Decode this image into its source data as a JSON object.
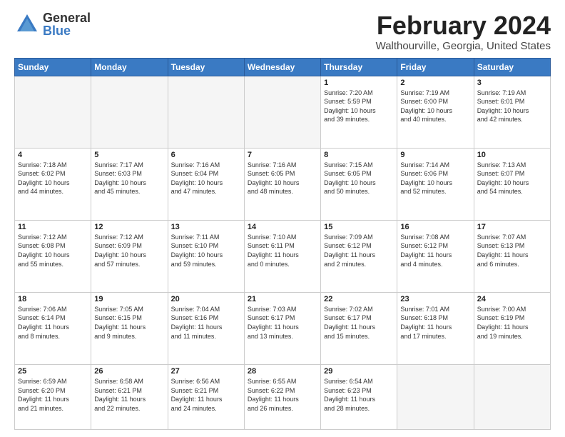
{
  "header": {
    "logo_general": "General",
    "logo_blue": "Blue",
    "month_title": "February 2024",
    "location": "Walthourville, Georgia, United States"
  },
  "weekdays": [
    "Sunday",
    "Monday",
    "Tuesday",
    "Wednesday",
    "Thursday",
    "Friday",
    "Saturday"
  ],
  "weeks": [
    [
      {
        "day": "",
        "info": ""
      },
      {
        "day": "",
        "info": ""
      },
      {
        "day": "",
        "info": ""
      },
      {
        "day": "",
        "info": ""
      },
      {
        "day": "1",
        "info": "Sunrise: 7:20 AM\nSunset: 5:59 PM\nDaylight: 10 hours\nand 39 minutes."
      },
      {
        "day": "2",
        "info": "Sunrise: 7:19 AM\nSunset: 6:00 PM\nDaylight: 10 hours\nand 40 minutes."
      },
      {
        "day": "3",
        "info": "Sunrise: 7:19 AM\nSunset: 6:01 PM\nDaylight: 10 hours\nand 42 minutes."
      }
    ],
    [
      {
        "day": "4",
        "info": "Sunrise: 7:18 AM\nSunset: 6:02 PM\nDaylight: 10 hours\nand 44 minutes."
      },
      {
        "day": "5",
        "info": "Sunrise: 7:17 AM\nSunset: 6:03 PM\nDaylight: 10 hours\nand 45 minutes."
      },
      {
        "day": "6",
        "info": "Sunrise: 7:16 AM\nSunset: 6:04 PM\nDaylight: 10 hours\nand 47 minutes."
      },
      {
        "day": "7",
        "info": "Sunrise: 7:16 AM\nSunset: 6:05 PM\nDaylight: 10 hours\nand 48 minutes."
      },
      {
        "day": "8",
        "info": "Sunrise: 7:15 AM\nSunset: 6:05 PM\nDaylight: 10 hours\nand 50 minutes."
      },
      {
        "day": "9",
        "info": "Sunrise: 7:14 AM\nSunset: 6:06 PM\nDaylight: 10 hours\nand 52 minutes."
      },
      {
        "day": "10",
        "info": "Sunrise: 7:13 AM\nSunset: 6:07 PM\nDaylight: 10 hours\nand 54 minutes."
      }
    ],
    [
      {
        "day": "11",
        "info": "Sunrise: 7:12 AM\nSunset: 6:08 PM\nDaylight: 10 hours\nand 55 minutes."
      },
      {
        "day": "12",
        "info": "Sunrise: 7:12 AM\nSunset: 6:09 PM\nDaylight: 10 hours\nand 57 minutes."
      },
      {
        "day": "13",
        "info": "Sunrise: 7:11 AM\nSunset: 6:10 PM\nDaylight: 10 hours\nand 59 minutes."
      },
      {
        "day": "14",
        "info": "Sunrise: 7:10 AM\nSunset: 6:11 PM\nDaylight: 11 hours\nand 0 minutes."
      },
      {
        "day": "15",
        "info": "Sunrise: 7:09 AM\nSunset: 6:12 PM\nDaylight: 11 hours\nand 2 minutes."
      },
      {
        "day": "16",
        "info": "Sunrise: 7:08 AM\nSunset: 6:12 PM\nDaylight: 11 hours\nand 4 minutes."
      },
      {
        "day": "17",
        "info": "Sunrise: 7:07 AM\nSunset: 6:13 PM\nDaylight: 11 hours\nand 6 minutes."
      }
    ],
    [
      {
        "day": "18",
        "info": "Sunrise: 7:06 AM\nSunset: 6:14 PM\nDaylight: 11 hours\nand 8 minutes."
      },
      {
        "day": "19",
        "info": "Sunrise: 7:05 AM\nSunset: 6:15 PM\nDaylight: 11 hours\nand 9 minutes."
      },
      {
        "day": "20",
        "info": "Sunrise: 7:04 AM\nSunset: 6:16 PM\nDaylight: 11 hours\nand 11 minutes."
      },
      {
        "day": "21",
        "info": "Sunrise: 7:03 AM\nSunset: 6:17 PM\nDaylight: 11 hours\nand 13 minutes."
      },
      {
        "day": "22",
        "info": "Sunrise: 7:02 AM\nSunset: 6:17 PM\nDaylight: 11 hours\nand 15 minutes."
      },
      {
        "day": "23",
        "info": "Sunrise: 7:01 AM\nSunset: 6:18 PM\nDaylight: 11 hours\nand 17 minutes."
      },
      {
        "day": "24",
        "info": "Sunrise: 7:00 AM\nSunset: 6:19 PM\nDaylight: 11 hours\nand 19 minutes."
      }
    ],
    [
      {
        "day": "25",
        "info": "Sunrise: 6:59 AM\nSunset: 6:20 PM\nDaylight: 11 hours\nand 21 minutes."
      },
      {
        "day": "26",
        "info": "Sunrise: 6:58 AM\nSunset: 6:21 PM\nDaylight: 11 hours\nand 22 minutes."
      },
      {
        "day": "27",
        "info": "Sunrise: 6:56 AM\nSunset: 6:21 PM\nDaylight: 11 hours\nand 24 minutes."
      },
      {
        "day": "28",
        "info": "Sunrise: 6:55 AM\nSunset: 6:22 PM\nDaylight: 11 hours\nand 26 minutes."
      },
      {
        "day": "29",
        "info": "Sunrise: 6:54 AM\nSunset: 6:23 PM\nDaylight: 11 hours\nand 28 minutes."
      },
      {
        "day": "",
        "info": ""
      },
      {
        "day": "",
        "info": ""
      }
    ]
  ]
}
